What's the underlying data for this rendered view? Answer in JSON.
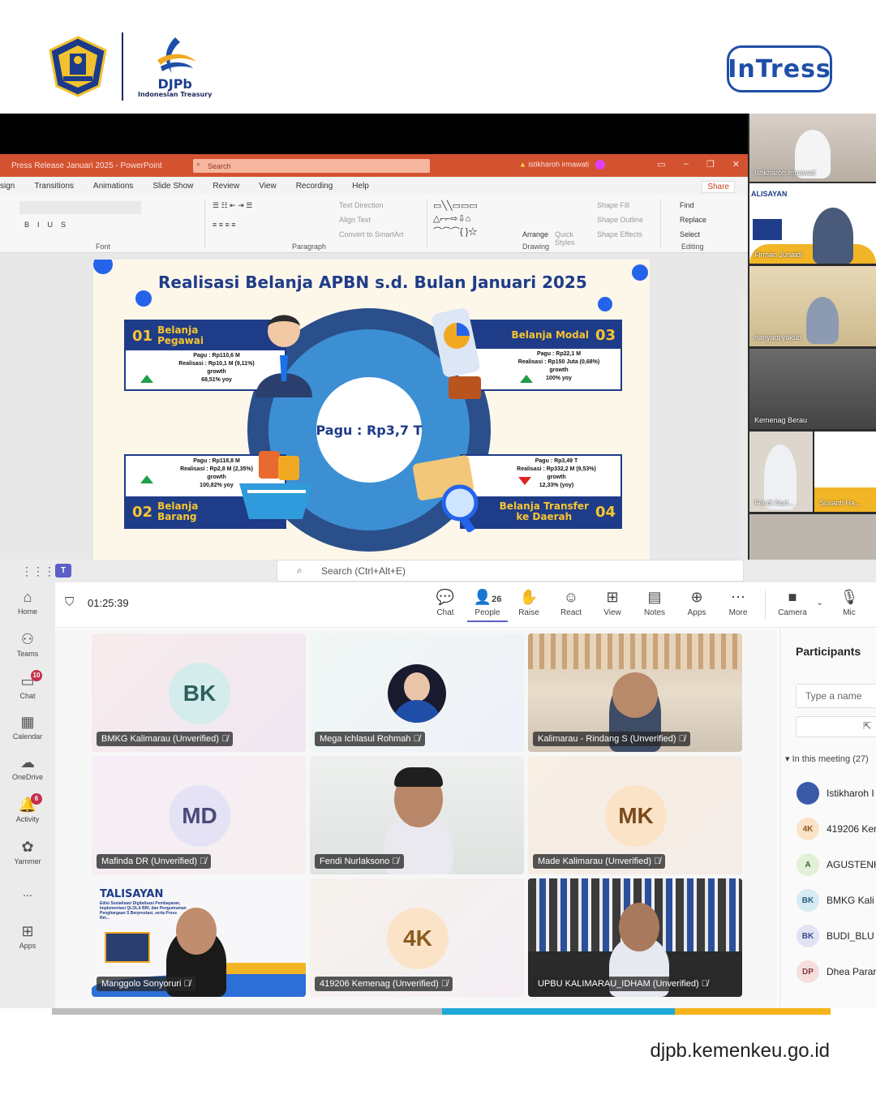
{
  "brand": {
    "org_name": "DJPb",
    "org_sub": "Indonesian Treasury",
    "event_logo": "InTress"
  },
  "ppt": {
    "title": "Press Release Januari 2025  -  PowerPoint",
    "search_placeholder": "Search",
    "user": "istikharoh irmawati",
    "menu": [
      "sign",
      "Transitions",
      "Animations",
      "Slide Show",
      "Review",
      "View",
      "Recording",
      "Help"
    ],
    "share": "Share",
    "groups": {
      "font": "Font",
      "paragraph": "Paragraph",
      "drawing": "Drawing",
      "editing": "Editing"
    },
    "ribbon": {
      "text_direction": "Text Direction",
      "align_text": "Align Text",
      "convert": "Convert to SmartArt",
      "arrange": "Arrange",
      "quick_styles": "Quick Styles",
      "shape_fill": "Shape Fill",
      "shape_outline": "Shape Outline",
      "shape_effects": "Shape Effects",
      "find": "Find",
      "replace": "Replace",
      "select": "Select"
    }
  },
  "slide": {
    "title": "Realisasi Belanja APBN s.d. Bulan Januari 2025",
    "center": "Pagu : Rp3,7 T",
    "cards": [
      {
        "num": "01",
        "name_1": "Belanja",
        "name_2": "Pegawai",
        "pagu": "Pagu : Rp110,6 M",
        "real": "Realisasi : Rp10,1 M (9,11%)",
        "growth_label": "growth",
        "growth": "68,51% yoy",
        "trend": "up"
      },
      {
        "num": "03",
        "name_1": "Belanja Modal",
        "name_2": "",
        "pagu": "Pagu : Rp22,1 M",
        "real": "Realisasi : Rp150 Juta (0,68%)",
        "growth_label": "growth",
        "growth": "100% yoy",
        "trend": "up"
      },
      {
        "num": "02",
        "name_1": "Belanja",
        "name_2": "Barang",
        "pagu": "Pagu : Rp118,8 M",
        "real": "Realisasi : Rp2,8 M (2,35%)",
        "growth_label": "growth",
        "growth": "100,82% yoy",
        "trend": "up"
      },
      {
        "num": "04",
        "name_1": "Belanja Transfer",
        "name_2": "ke Daerah",
        "pagu": "Pagu : Rp3,49 T",
        "real": "Realisasi : Rp332,2 M (9,53%)",
        "growth_label": "growth",
        "growth": "12,33% (yoy)",
        "trend": "down"
      }
    ]
  },
  "side_videos": [
    {
      "name": "Istikharoh Irmawati"
    },
    {
      "name": "Firman Junaidi",
      "slide_title": "ALISAYAN"
    },
    {
      "name": "hariyadi yakub"
    },
    {
      "name": "Kemenag Berau"
    },
    {
      "name": "Fendi Nurl..."
    },
    {
      "name": "Susanti Ha..."
    }
  ],
  "teams": {
    "search": "Search (Ctrl+Alt+E)",
    "timer": "01:25:39",
    "rail": [
      {
        "label": "Home",
        "icon": "home-icon"
      },
      {
        "label": "Teams",
        "icon": "teams-icon"
      },
      {
        "label": "Chat",
        "icon": "chat-icon",
        "badge": "10"
      },
      {
        "label": "Calendar",
        "icon": "calendar-icon"
      },
      {
        "label": "OneDrive",
        "icon": "cloud-icon"
      },
      {
        "label": "Activity",
        "icon": "bell-icon",
        "badge": "6"
      },
      {
        "label": "Yammer",
        "icon": "yammer-icon"
      },
      {
        "label": "...",
        "icon": "more-icon"
      },
      {
        "label": "Apps",
        "icon": "plus-icon"
      }
    ],
    "controls": [
      {
        "label": "Chat",
        "glyph": "💬"
      },
      {
        "label": "People",
        "glyph": "👤",
        "count": "26"
      },
      {
        "label": "Raise",
        "glyph": "✋"
      },
      {
        "label": "React",
        "glyph": "☺"
      },
      {
        "label": "View",
        "glyph": "⊞"
      },
      {
        "label": "Notes",
        "glyph": "▤"
      },
      {
        "label": "Apps",
        "glyph": "⊕"
      },
      {
        "label": "More",
        "glyph": "⋯"
      },
      {
        "label": "Camera",
        "glyph": "■"
      },
      {
        "label": "Mic",
        "glyph": "🎙"
      }
    ],
    "tiles": [
      {
        "name": "BMKG Kalimarau (Unverified)",
        "initials": "BK"
      },
      {
        "name": "Mega Ichlasul Rohmah",
        "initials": ""
      },
      {
        "name": "Kalimarau - Rindang S (Unverified)",
        "initials": ""
      },
      {
        "name": "Mafinda DR (Unverified)",
        "initials": "MD"
      },
      {
        "name": "Fendi Nurlaksono",
        "initials": ""
      },
      {
        "name": "Made Kalimarau (Unverified)",
        "initials": "MK"
      },
      {
        "name": "Manggolo Sonyoruri",
        "initials": "",
        "slide_title": "TALISAYAN",
        "slide_sub": "Edisi Sosialisasi Digitalisasi Pembayaran, Implementasi QLOLA BRI, dan Pengumuman Penghargaan S Berprestasi, serta Press Rel..."
      },
      {
        "name": "419206 Kemenag (Unverified)",
        "initials": "4K"
      },
      {
        "name": "UPBU KALIMARAU_IDHAM (Unverified)",
        "initials": ""
      }
    ],
    "panel": {
      "title": "Participants",
      "input_placeholder": "Type a name",
      "in_meeting": "In this meeting (27)",
      "list": [
        {
          "initials": "",
          "name": "Istikharoh I"
        },
        {
          "initials": "4K",
          "name": "419206 Ker"
        },
        {
          "initials": "A",
          "name": "AGUSTENH"
        },
        {
          "initials": "BK",
          "name": "BMKG Kali"
        },
        {
          "initials": "BK",
          "name": "BUDI_BLU"
        },
        {
          "initials": "DP",
          "name": "Dhea Parar"
        }
      ]
    }
  },
  "footer": {
    "url": "djpb.kemenkeu.go.id"
  },
  "colors": {
    "ppt_orange": "#d35230",
    "teams_purple": "#5b5fc7",
    "slide_navy": "#1f3c88",
    "slide_yellow": "#f8c530",
    "footer_gray": "#bdbdbd",
    "footer_blue": "#1ea9d8",
    "footer_yellow": "#f4b41a"
  }
}
